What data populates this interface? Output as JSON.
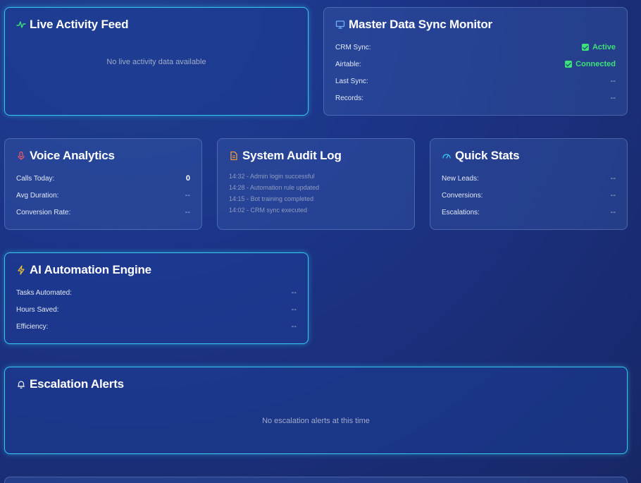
{
  "live_activity": {
    "title": "Live Activity Feed",
    "empty_text": "No live activity data available"
  },
  "sync_monitor": {
    "title": "Master Data Sync Monitor",
    "rows": [
      {
        "label": "CRM Sync:",
        "value": "Active"
      },
      {
        "label": "Airtable:",
        "value": "Connected"
      },
      {
        "label": "Last Sync:",
        "value": "--"
      },
      {
        "label": "Records:",
        "value": "--"
      }
    ]
  },
  "voice_analytics": {
    "title": "Voice Analytics",
    "rows": [
      {
        "label": "Calls Today:",
        "value": "0"
      },
      {
        "label": "Avg Duration:",
        "value": "--"
      },
      {
        "label": "Conversion Rate:",
        "value": "--"
      }
    ]
  },
  "audit_log": {
    "title": "System Audit Log",
    "entries": [
      "14:32 - Admin login successful",
      "14:28 - Automation rule updated",
      "14:15 - Bot training completed",
      "14:02 - CRM sync executed"
    ]
  },
  "quick_stats": {
    "title": "Quick Stats",
    "rows": [
      {
        "label": "New Leads:",
        "value": "--"
      },
      {
        "label": "Conversions:",
        "value": "--"
      },
      {
        "label": "Escalations:",
        "value": "--"
      }
    ]
  },
  "automation_engine": {
    "title": "AI Automation Engine",
    "rows": [
      {
        "label": "Tasks Automated:",
        "value": "--"
      },
      {
        "label": "Hours Saved:",
        "value": "--"
      },
      {
        "label": "Efficiency:",
        "value": "--"
      }
    ]
  },
  "escalation_alerts": {
    "title": "Escalation Alerts",
    "empty_text": "No escalation alerts at this time"
  },
  "colors": {
    "accent_cyan": "#36c9f0",
    "status_green": "#3ee07a",
    "activity_icon": "#3ee07a",
    "voice_icon": "#e8596a",
    "audit_icon": "#f29a3a",
    "stats_icon": "#36c9f0",
    "automation_icon": "#f2c230"
  },
  "icons": {
    "live_activity": "activity-pulse-icon",
    "sync_monitor": "monitor-icon",
    "voice_analytics": "microphone-icon",
    "audit_log": "document-icon",
    "quick_stats": "gauge-icon",
    "automation_engine": "lightning-icon",
    "escalation_alerts": "bell-icon"
  }
}
